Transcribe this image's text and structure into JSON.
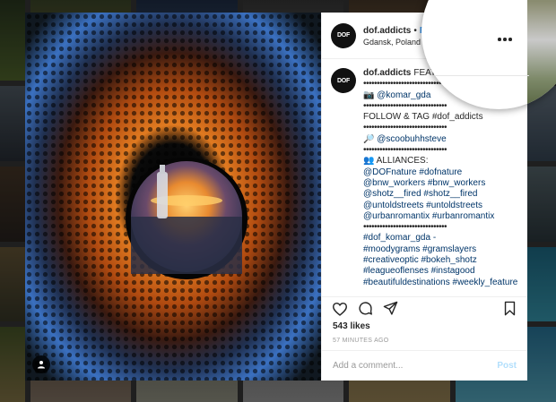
{
  "post": {
    "username": "dof.addicts",
    "follow_label": "Fo",
    "location": "Gdansk, Poland",
    "avatar_text": "DOF"
  },
  "caption": {
    "lines": [
      "FEATURE",
      "•••••••••••••••••••••••••••••••",
      "📷 @komar_gda",
      "•••••••••••••••••••••••••••••••",
      "FOLLOW & TAG #dof_addicts",
      "•••••••••••••••••••••••••••••••",
      "🔎 @scoobuhhsteve",
      "•••••••••••••••••••••••••••••••",
      "👥 ALLIANCES:",
      "@DOFnature #dofnature",
      "@bnw_workers #bnw_workers",
      "@shotz__fired #shotz__fired",
      "@untoldstreets #untoldstreets",
      "@urbanromantix #urbanromantix",
      "•••••••••••••••••••••••••••••••",
      "#dof_komar_gda -",
      "#moodygrams #gramslayers",
      "#creativeoptic #bokeh_shotz",
      "#leagueoflenses #instagood",
      "#beautifuldestinations #weekly_feature"
    ]
  },
  "stats": {
    "likes": "543 likes",
    "time": "57 MINUTES AGO"
  },
  "comment": {
    "placeholder": "Add a comment...",
    "post_label": "Post"
  },
  "icons": {
    "like": "heart-icon",
    "comment": "comment-icon",
    "share": "share-icon",
    "save": "bookmark-icon",
    "more": "more-options-icon",
    "tag": "user-tag-icon"
  },
  "colors": {
    "link": "#003569",
    "follow": "#3897f0",
    "post_disabled": "#b2dffc"
  }
}
